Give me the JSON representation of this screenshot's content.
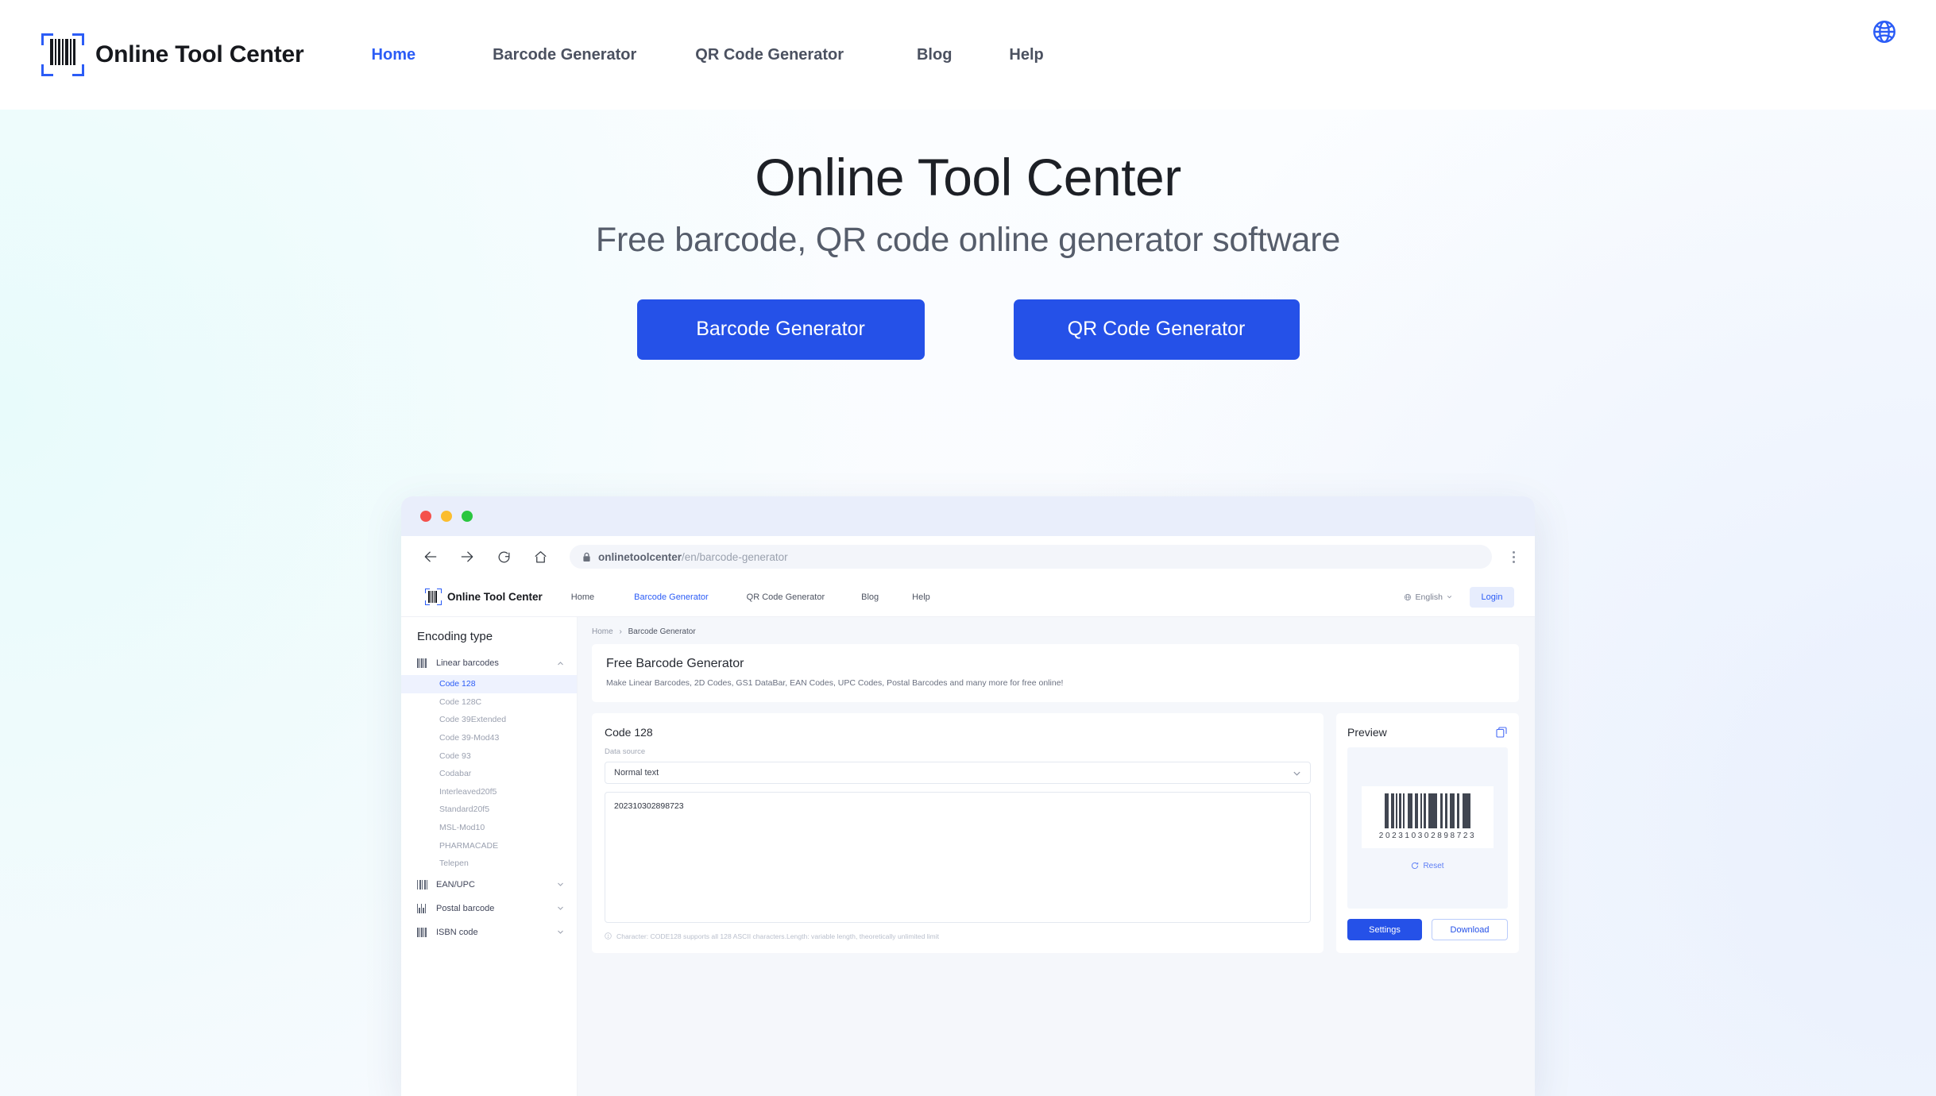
{
  "brand": {
    "name": "Online Tool Center",
    "accent": "#2b5cf6"
  },
  "topnav": {
    "items": [
      {
        "label": "Home",
        "active": true
      },
      {
        "label": "Barcode Generator",
        "active": false
      },
      {
        "label": "QR Code Generator",
        "active": false
      },
      {
        "label": "Blog",
        "active": false
      },
      {
        "label": "Help",
        "active": false
      }
    ],
    "language_icon": "globe-icon"
  },
  "hero": {
    "title": "Online Tool Center",
    "subtitle": "Free barcode, QR code online generator software",
    "primary_cta": "Barcode Generator",
    "secondary_cta": "QR Code Generator"
  },
  "browser": {
    "traffic_lights": [
      "red",
      "yellow",
      "green"
    ],
    "back_icon": "arrow-left-icon",
    "forward_icon": "arrow-right-icon",
    "reload_icon": "reload-icon",
    "home_icon": "home-icon",
    "lock_icon": "lock-icon",
    "url_host": "onlinetoolcenter",
    "url_path": "/en/barcode-generator",
    "menu_icon": "kebab-menu-icon"
  },
  "site": {
    "logo_text": "Online Tool Center",
    "menu": [
      {
        "label": "Home",
        "active": false
      },
      {
        "label": "Barcode Generator",
        "active": true
      },
      {
        "label": "QR Code Generator",
        "active": false
      },
      {
        "label": "Blog",
        "active": false
      },
      {
        "label": "Help",
        "active": false
      }
    ],
    "language": "English",
    "login_label": "Login",
    "sidebar": {
      "title": "Encoding type",
      "groups": [
        {
          "label": "Linear barcodes",
          "expanded": true,
          "items": [
            {
              "label": "Code 128",
              "active": true
            },
            {
              "label": "Code 128C",
              "active": false
            },
            {
              "label": "Code 39Extended",
              "active": false
            },
            {
              "label": "Code 39-Mod43",
              "active": false
            },
            {
              "label": "Code 93",
              "active": false
            },
            {
              "label": "Codabar",
              "active": false
            },
            {
              "label": "Interleaved20f5",
              "active": false
            },
            {
              "label": "Standard20f5",
              "active": false
            },
            {
              "label": "MSL-Mod10",
              "active": false
            },
            {
              "label": "PHARMACADE",
              "active": false
            },
            {
              "label": "Telepen",
              "active": false
            }
          ]
        },
        {
          "label": "EAN/UPC",
          "expanded": false,
          "items": []
        },
        {
          "label": "Postal barcode",
          "expanded": false,
          "items": []
        },
        {
          "label": "ISBN code",
          "expanded": false,
          "items": []
        }
      ]
    },
    "breadcrumb": {
      "home": "Home",
      "separator": "›",
      "current": "Barcode Generator"
    },
    "intro": {
      "title": "Free Barcode Generator",
      "description": "Make Linear Barcodes, 2D Codes, GS1 DataBar, EAN Codes, UPC Codes, Postal Barcodes and many more for free online!"
    },
    "editor": {
      "title": "Code 128",
      "data_source_label": "Data source",
      "data_source_value": "Normal text",
      "input_value": "202310302898723",
      "hint": "Character: CODE128 supports all 128 ASCII characters.Length: variable length, theoretically unlimited limit"
    },
    "preview": {
      "title": "Preview",
      "copy_icon": "copy-icon",
      "barcode_digits": "202310302898723",
      "reset_label": "Reset",
      "settings_label": "Settings",
      "download_label": "Download"
    }
  }
}
